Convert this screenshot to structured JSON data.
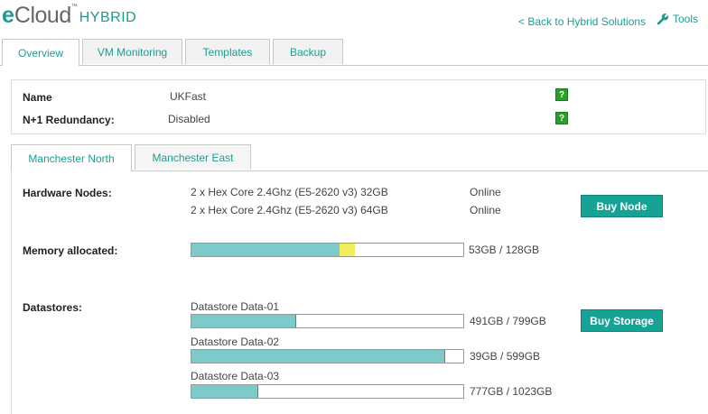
{
  "header": {
    "logo_e": "e",
    "logo_cloud": "Cloud",
    "logo_tm": "™",
    "logo_hybrid": "HYBRID",
    "back_link": "< Back to Hybrid Solutions",
    "tools": "Tools"
  },
  "tabs": [
    "Overview",
    "VM Monitoring",
    "Templates",
    "Backup"
  ],
  "info": {
    "name_label": "Name",
    "name_value": "UKFast",
    "redundancy_label": "N+1 Redundancy:",
    "redundancy_value": "Disabled",
    "help_glyph": "?"
  },
  "subtabs": [
    "Manchester North",
    "Manchester East"
  ],
  "hardware": {
    "label": "Hardware Nodes:",
    "nodes": [
      {
        "spec": "2 x Hex Core 2.4Ghz (E5-2620 v3) 32GB",
        "status": "Online"
      },
      {
        "spec": "2 x Hex Core 2.4Ghz (E5-2620 v3) 64GB",
        "status": "Online"
      }
    ],
    "buy_button": "Buy Node"
  },
  "memory": {
    "label": "Memory allocated:",
    "used_fraction": 0.545,
    "pending_fraction": 0.055,
    "text": "53GB / 128GB"
  },
  "datastores": {
    "label": "Datastores:",
    "buy_button": "Buy Storage",
    "items": [
      {
        "name": "Datastore Data-01",
        "text": "491GB / 799GB",
        "fraction": 0.387
      },
      {
        "name": "Datastore Data-02",
        "text": "39GB / 599GB",
        "fraction": 0.935
      },
      {
        "name": "Datastore Data-03",
        "text": "777GB / 1023GB",
        "fraction": 0.245
      }
    ]
  },
  "colors": {
    "accent": "#1a9e92",
    "bar_fill": "#7ccaca",
    "bar_pending": "#f0ec5a",
    "button": "#16a396",
    "help": "#2c9c2c"
  }
}
